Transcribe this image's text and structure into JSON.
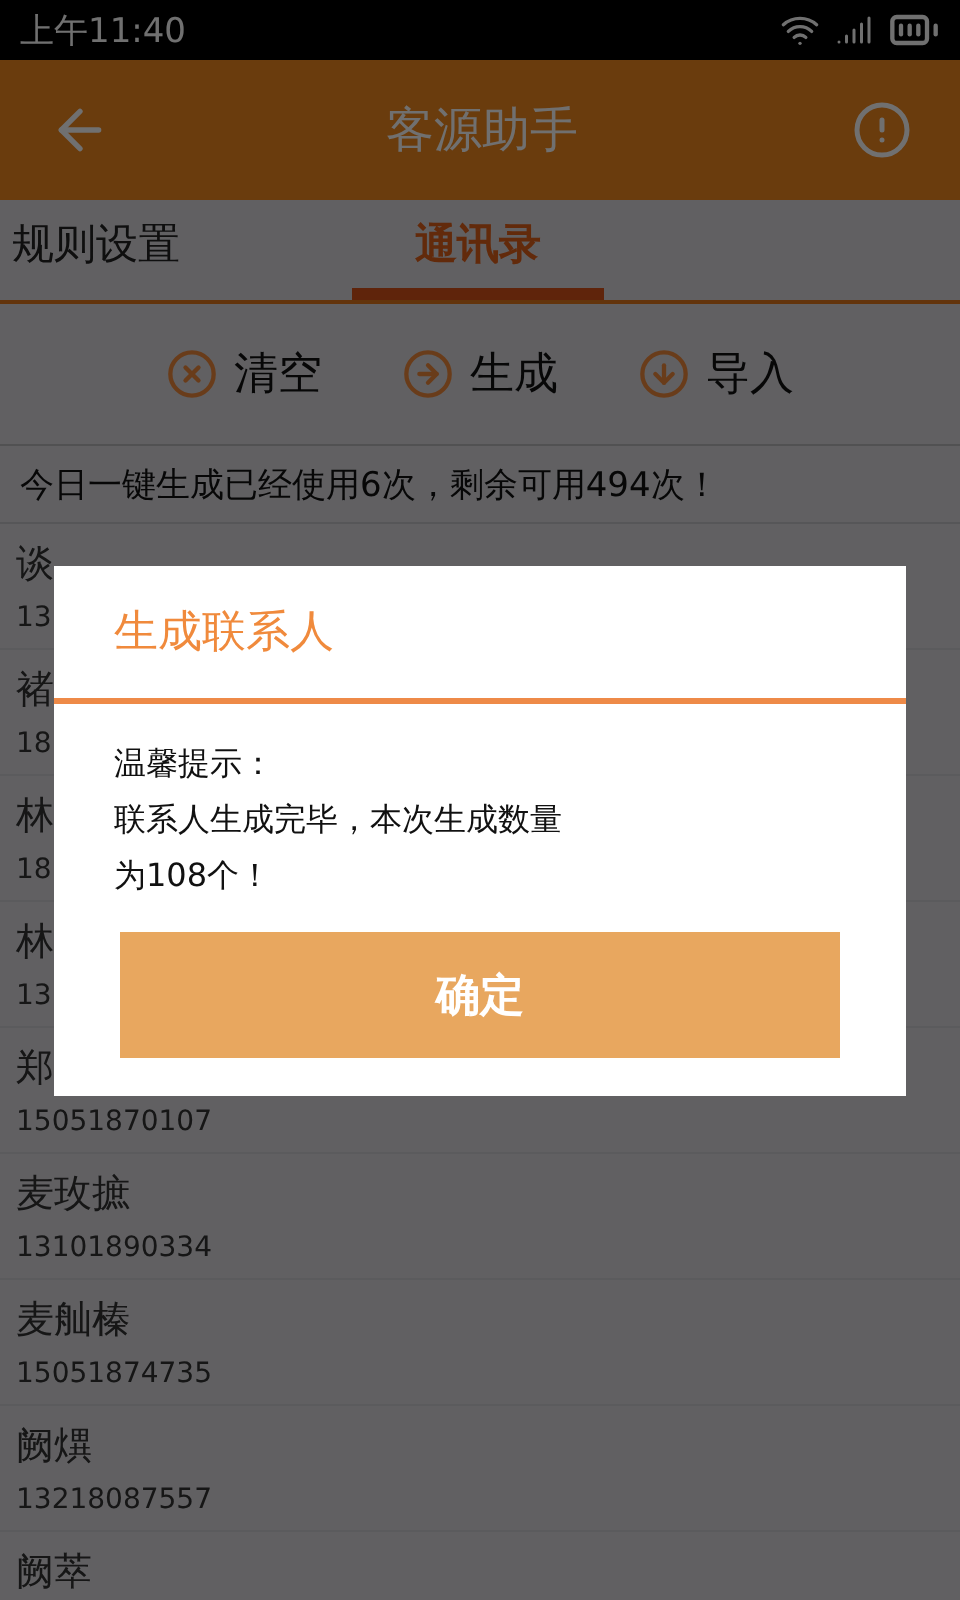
{
  "status_bar": {
    "time": "上午11:40"
  },
  "header": {
    "title": "客源助手"
  },
  "tabs": [
    {
      "label": "规则设置",
      "selected": false
    },
    {
      "label": "通讯录",
      "selected": true
    }
  ],
  "toolbar": [
    {
      "kind": "clear",
      "label": "清空"
    },
    {
      "kind": "generate",
      "label": "生成"
    },
    {
      "kind": "import",
      "label": "导入"
    }
  ],
  "notice": "今日一键生成已经使用6次，剩余可用494次！",
  "contacts": [
    {
      "name": "谈",
      "phone": "13"
    },
    {
      "name": "褚",
      "phone": "18"
    },
    {
      "name": "林",
      "phone": "18"
    },
    {
      "name": "林",
      "phone": "13"
    },
    {
      "name": "郑",
      "phone": "15051870107"
    },
    {
      "name": "麦玫摭",
      "phone": "13101890334"
    },
    {
      "name": "麦舢榛",
      "phone": "15051874735"
    },
    {
      "name": "阙熼",
      "phone": "13218087557"
    },
    {
      "name": "阙萃"
    }
  ],
  "dialog": {
    "title": "生成联系人",
    "message": [
      "温馨提示：",
      "联系人生成完毕，本次生成数量",
      "为108个！"
    ],
    "button": "确定"
  }
}
